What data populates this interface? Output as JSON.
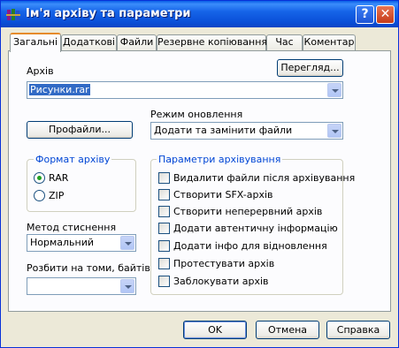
{
  "window": {
    "title": "Ім'я архіву та параметри",
    "help_label": "?",
    "close_label": "✕",
    "app_icon": "winrar-books-icon"
  },
  "tabs": [
    {
      "label": "Загальні",
      "active": true
    },
    {
      "label": "Додаткові"
    },
    {
      "label": "Файли"
    },
    {
      "label": "Резервне копіювання"
    },
    {
      "label": "Час"
    },
    {
      "label": "Коментар"
    }
  ],
  "archive": {
    "label": "Архів",
    "value": "Рисунки.rar",
    "browse_label": "Перегляд..."
  },
  "profiles_label": "Профайли...",
  "update_mode": {
    "label": "Режим оновлення",
    "value": "Додати та замінити файли"
  },
  "format": {
    "title": "Формат архіву",
    "options": [
      {
        "label": "RAR",
        "selected": true
      },
      {
        "label": "ZIP",
        "selected": false
      }
    ]
  },
  "method": {
    "label": "Метод стиснення",
    "value": "Нормальний"
  },
  "split": {
    "label": "Розбити на томи, байтів",
    "value": ""
  },
  "options": {
    "title": "Параметри архівування",
    "items": [
      {
        "label": "Видалити файли після архівування",
        "checked": false
      },
      {
        "label": "Створити SFX-архів",
        "checked": false
      },
      {
        "label": "Створити неперервний архів",
        "checked": false
      },
      {
        "label": "Додати автентичну інформацію",
        "checked": false
      },
      {
        "label": "Додати інфо для відновлення",
        "checked": false
      },
      {
        "label": "Протестувати архів",
        "checked": false
      },
      {
        "label": "Заблокувати архів",
        "checked": false
      }
    ]
  },
  "buttons": {
    "ok": "OK",
    "cancel": "Отмена",
    "help": "Справка"
  }
}
